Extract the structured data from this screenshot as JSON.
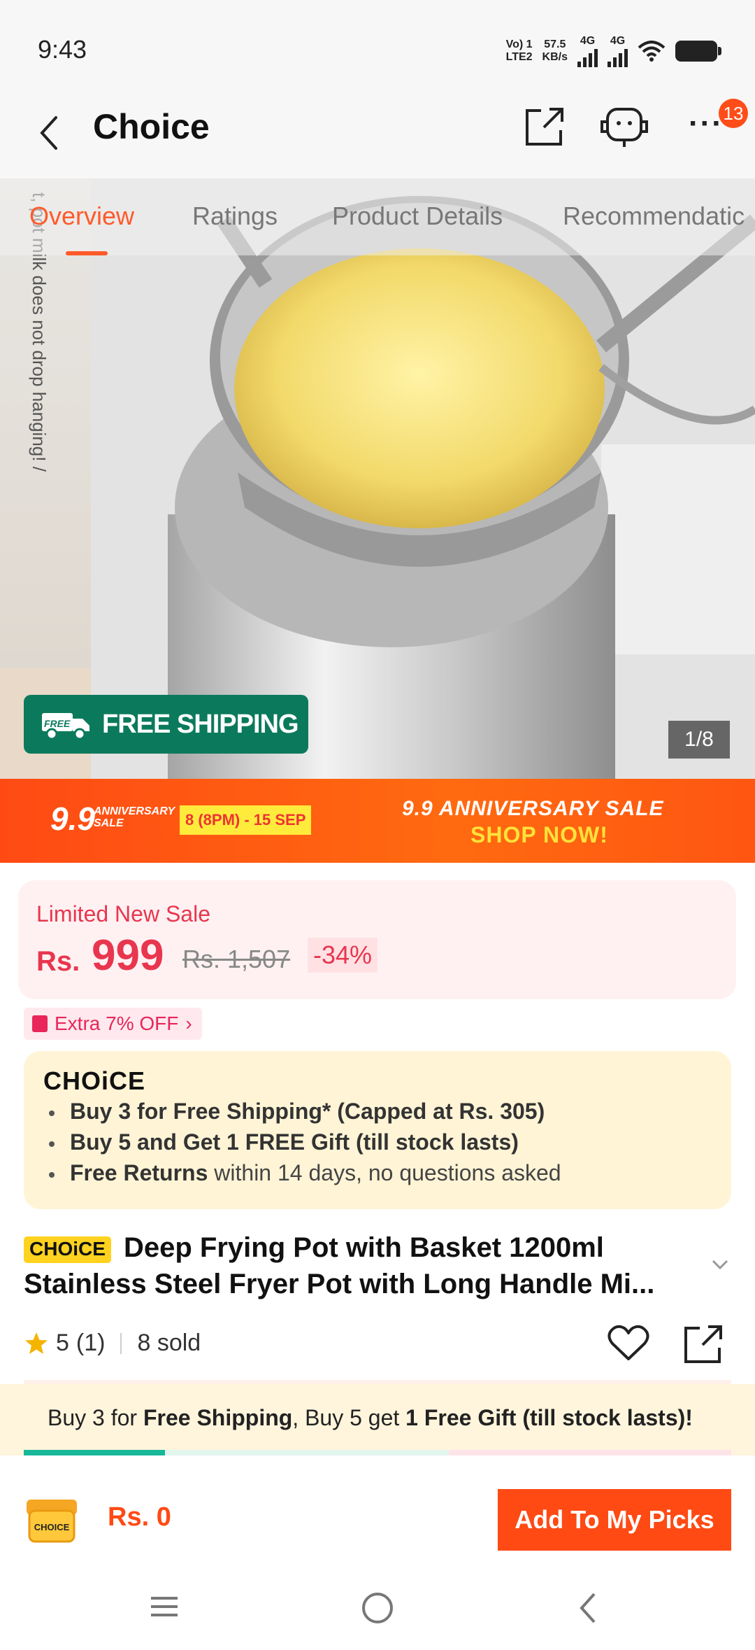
{
  "status_bar": {
    "time": "9:43",
    "volte": "Vo) 1",
    "lte": "LTE2",
    "speed_value": "57.5",
    "speed_unit": "KB/s",
    "net1": "4G",
    "net2": "4G",
    "icons": [
      "signal-icon",
      "signal-icon",
      "wifi-icon",
      "battery-icon"
    ]
  },
  "header": {
    "title": "Choice",
    "cart_badge_count": "13",
    "icons": [
      "back-arrow-icon",
      "share-icon",
      "customer-support-icon",
      "more-icon"
    ]
  },
  "tabs": [
    {
      "label": "Overview",
      "active": true
    },
    {
      "label": "Ratings",
      "active": false
    },
    {
      "label": "Product Details",
      "active": false
    },
    {
      "label": "Recommendatic",
      "active": false
    }
  ],
  "hero": {
    "vertical_text": "t, pot milk does not drop hanging! /",
    "free_shipping_label": "FREE SHIPPING",
    "free_shipping_truck_text": "FREE",
    "image_counter": "1/8"
  },
  "promo_banner": {
    "logo_big": "9.9",
    "logo_small_1": "ANNIVERSARY",
    "logo_small_2": "SALE",
    "date_range": "8 (8PM) - 15 SEP",
    "headline": "9.9 ANNIVERSARY SALE",
    "cta": "SHOP NOW!"
  },
  "price": {
    "label": "Limited New Sale",
    "currency": "Rs.",
    "current": "999",
    "original": "Rs. 1,507",
    "discount": "-34%"
  },
  "coupon": {
    "label": "Extra 7% OFF"
  },
  "choice_benefits": {
    "logo": "CHOiCE",
    "items": [
      {
        "strong": "Buy 3 for  Free Shipping* (Capped at Rs. 305)",
        "rest": ""
      },
      {
        "strong": "Buy 5 and Get 1 FREE Gift (till stock lasts)",
        "rest": ""
      },
      {
        "strong": "Free Returns",
        "rest": " within 14 days, no questions asked"
      }
    ]
  },
  "product": {
    "tag": "CHOiCE",
    "title": "Deep Frying Pot with Basket 1200ml Stainless Steel Fryer Pot with Long Handle Mi...",
    "rating": "5",
    "rating_count": "(1)",
    "sold": "8 sold"
  },
  "bundle_bar": {
    "p1": "Buy 3 for ",
    "b1": "Free Shipping",
    "p2": ", Buy 5 get ",
    "b2": "1 Free Gift (till stock lasts)!",
    "progress_fraction": 0.2
  },
  "bottom_bar": {
    "cart_label": "CHOICE",
    "total": "Rs. 0",
    "add_button": "Add To My Picks"
  },
  "colors": {
    "accent": "#ff4a14",
    "price_red": "#e8364f",
    "free_shipping_green": "#0b7a5c",
    "choice_yellow": "#ffd21f"
  }
}
